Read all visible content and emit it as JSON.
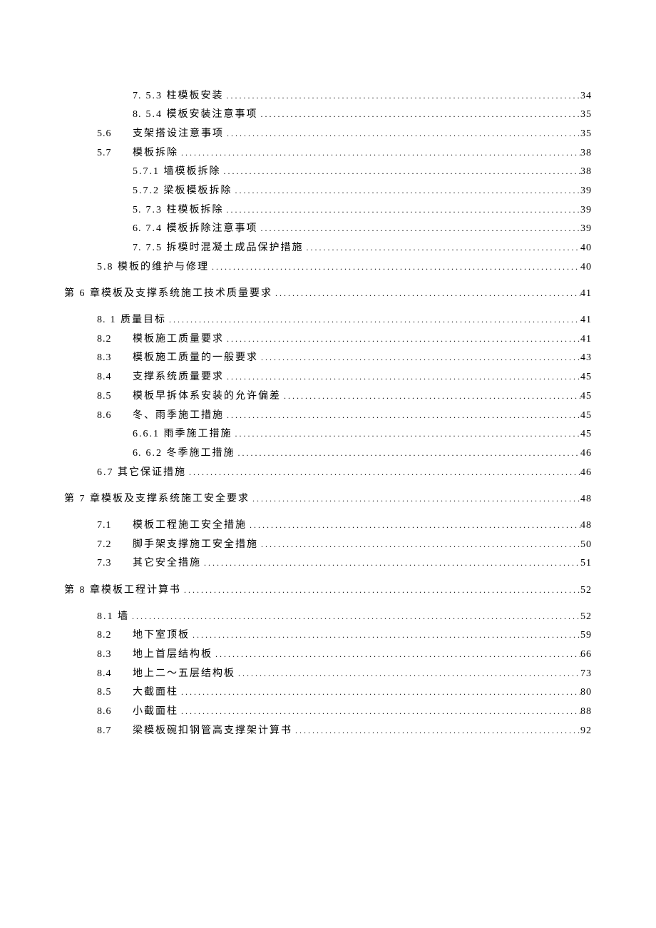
{
  "toc": [
    {
      "indent": 2,
      "num": "7.",
      "label": "5.3 柱模板安装",
      "page": "34"
    },
    {
      "indent": 2,
      "num": "8.",
      "label": "5.4 模板安装注意事项",
      "page": "35"
    },
    {
      "indent": 1,
      "num": "5.6",
      "wide": true,
      "label": "支架搭设注意事项",
      "page": "35"
    },
    {
      "indent": 1,
      "num": "5.7",
      "wide": true,
      "label": "模板拆除",
      "page": "38"
    },
    {
      "indent": 2,
      "num": "",
      "label": "5.7.1 墙模板拆除",
      "page": "38"
    },
    {
      "indent": 2,
      "num": "",
      "label": "5.7.2 梁板模板拆除",
      "page": "39"
    },
    {
      "indent": 2,
      "num": "5.",
      "label": "7.3 柱模板拆除",
      "page": "39"
    },
    {
      "indent": 2,
      "num": "6.",
      "label": "7.4 模板拆除注意事项",
      "page": "39"
    },
    {
      "indent": 2,
      "num": "7.",
      "label": "7.5 拆模时混凝土成品保护措施",
      "page": "40"
    },
    {
      "indent": 1,
      "num": "",
      "label": "5.8 模板的维护与修理",
      "page": "40"
    },
    {
      "indent": 0,
      "num": "",
      "label": "第 6 章模板及支撑系统施工技术质量要求",
      "page": "41",
      "gap": true
    },
    {
      "indent": 1,
      "num": "8.",
      "label": "1 质量目标",
      "page": "41",
      "gap": true
    },
    {
      "indent": 1,
      "num": "8.2",
      "wide": true,
      "label": "模板施工质量要求",
      "page": "41"
    },
    {
      "indent": 1,
      "num": "8.3",
      "wide": true,
      "label": "模板施工质量的一般要求",
      "page": "43"
    },
    {
      "indent": 1,
      "num": "8.4",
      "wide": true,
      "label": "支撑系统质量要求",
      "page": "45"
    },
    {
      "indent": 1,
      "num": "8.5",
      "wide": true,
      "label": "模板早拆体系安装的允许偏差",
      "page": "45"
    },
    {
      "indent": 1,
      "num": "8.6",
      "wide": true,
      "label": "冬、雨季施工措施",
      "page": "45"
    },
    {
      "indent": 2,
      "num": "",
      "label": "6.6.1 雨季施工措施 ",
      "page": "45"
    },
    {
      "indent": 2,
      "num": "6.",
      "label": "6.2 冬季施工措施",
      "page": "46"
    },
    {
      "indent": 1,
      "num": "",
      "label": "6.7 其它保证措施",
      "page": "46"
    },
    {
      "indent": 0,
      "num": "",
      "label": "第 7 章模板及支撑系统施工安全要求",
      "page": "48",
      "gap": true
    },
    {
      "indent": 1,
      "num": "7.1",
      "wide": true,
      "label": "模板工程施工安全措施",
      "page": "48",
      "gap": true
    },
    {
      "indent": 1,
      "num": "7.2",
      "wide": true,
      "label": "脚手架支撑施工安全措施",
      "page": "50"
    },
    {
      "indent": 1,
      "num": "7.3",
      "wide": true,
      "label": "其它安全措施",
      "page": "51"
    },
    {
      "indent": 0,
      "num": "",
      "label": "第 8 章模板工程计算书",
      "page": "52",
      "gap": true
    },
    {
      "indent": 1,
      "num": "",
      "label": "8.1 墙",
      "page": "52",
      "gap": true
    },
    {
      "indent": 1,
      "num": "8.2",
      "wide": true,
      "label": "地下室顶板",
      "page": "59"
    },
    {
      "indent": 1,
      "num": "8.3",
      "wide": true,
      "label": "地上首层结构板",
      "page": "66"
    },
    {
      "indent": 1,
      "num": "8.4",
      "wide": true,
      "label": "地上二～五层结构板",
      "page": "73"
    },
    {
      "indent": 1,
      "num": "8.5",
      "wide": true,
      "label": "大截面柱",
      "page": "80"
    },
    {
      "indent": 1,
      "num": "8.6",
      "wide": true,
      "label": "小截面柱",
      "page": "88"
    },
    {
      "indent": 1,
      "num": "8.7",
      "wide": true,
      "label": "梁模板碗扣钢管高支撑架计算书",
      "page": "92"
    }
  ]
}
